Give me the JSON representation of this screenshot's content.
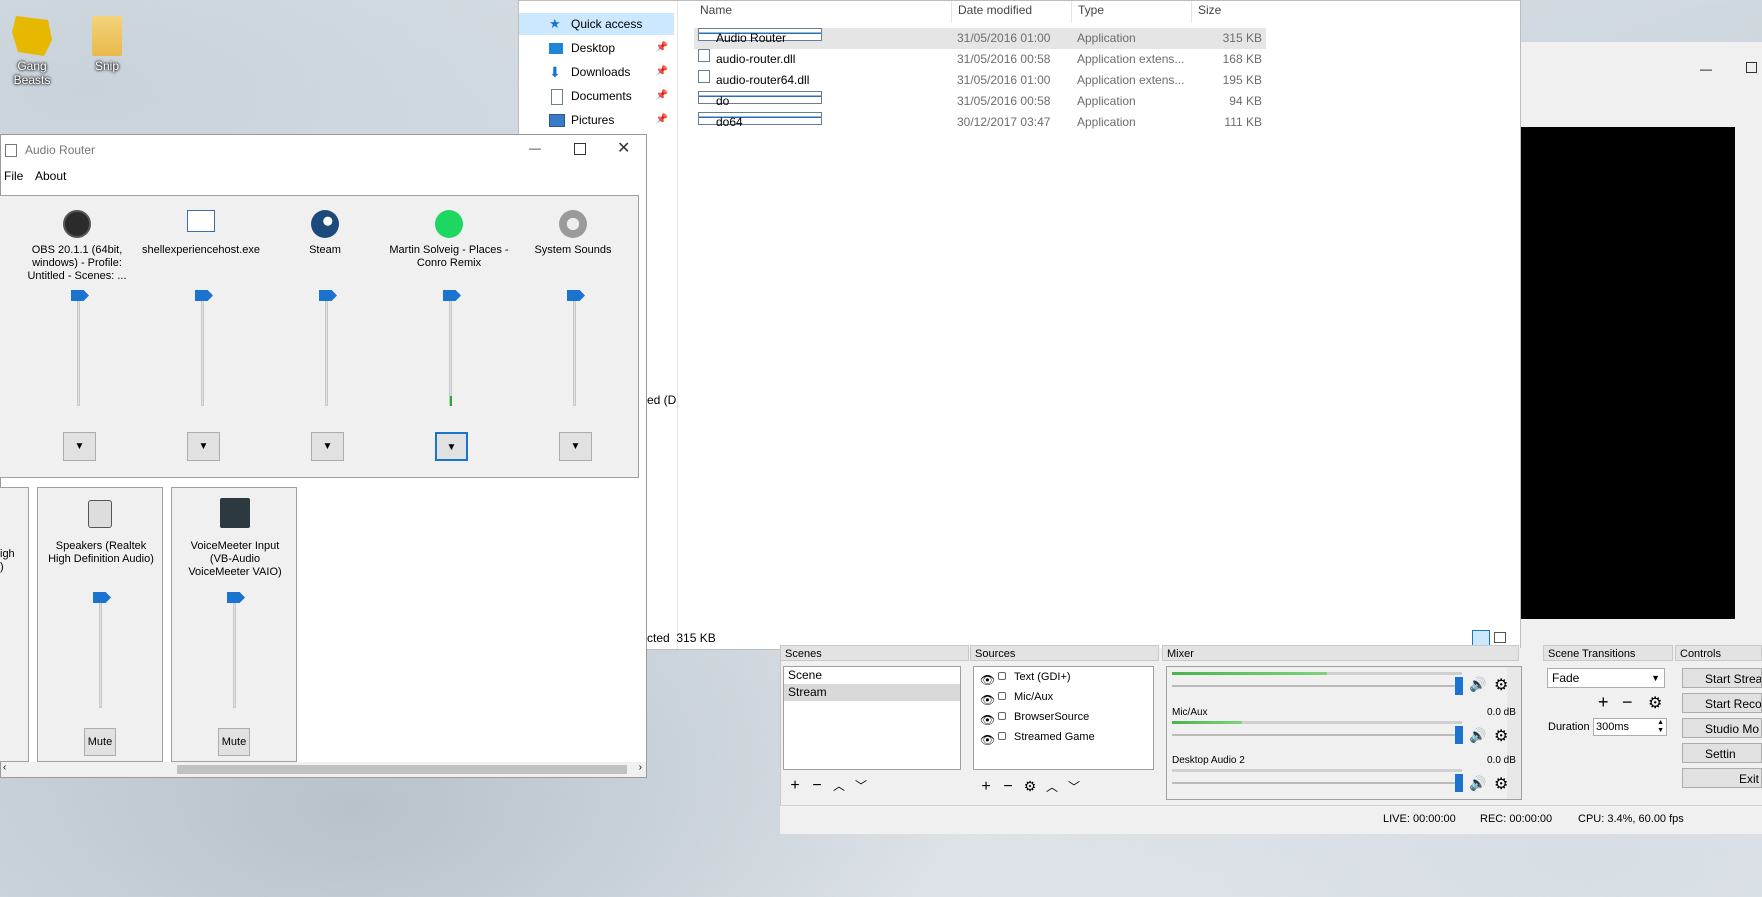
{
  "desktop": {
    "icons": [
      {
        "label": "Gang Beasts"
      },
      {
        "label": "Snip"
      }
    ]
  },
  "explorer": {
    "nav": [
      {
        "label": "Quick access",
        "icon": "star-icon"
      },
      {
        "label": "Desktop",
        "icon": "desktop-folder-icon",
        "pinned": true
      },
      {
        "label": "Downloads",
        "icon": "downloads-folder-icon",
        "pinned": true
      },
      {
        "label": "Documents",
        "icon": "documents-folder-icon",
        "pinned": true
      },
      {
        "label": "Pictures",
        "icon": "pictures-folder-icon",
        "pinned": true
      }
    ],
    "columns": [
      "Name",
      "Date modified",
      "Type",
      "Size"
    ],
    "files": [
      {
        "name": "Audio Router",
        "date": "31/05/2016 01:00",
        "type": "Application",
        "size": "315 KB"
      },
      {
        "name": "audio-router.dll",
        "date": "31/05/2016 00:58",
        "type": "Application extens...",
        "size": "168 KB"
      },
      {
        "name": "audio-router64.dll",
        "date": "31/05/2016 01:00",
        "type": "Application extens...",
        "size": "195 KB"
      },
      {
        "name": "do",
        "date": "31/05/2016 00:58",
        "type": "Application",
        "size": "94 KB"
      },
      {
        "name": "do64",
        "date": "30/12/2017 03:47",
        "type": "Application",
        "size": "111 KB"
      }
    ],
    "partial_side_text": "ed (D",
    "status": "cted  315 KB"
  },
  "audio_router": {
    "title": "Audio Router",
    "menu": [
      "File",
      "About"
    ],
    "apps": [
      {
        "label": "OBS 20.1.1 (64bit, windows) - Profile: Untitled - Scenes: ...",
        "icon": "obs-icon"
      },
      {
        "label": "shellexperiencehost.exe",
        "icon": "window-icon"
      },
      {
        "label": "Steam",
        "icon": "steam-icon"
      },
      {
        "label": "Martin Solveig - Places - Conro Remix",
        "icon": "spotify-icon"
      },
      {
        "label": "System Sounds",
        "icon": "speaker-icon"
      }
    ],
    "devices_partial": "igh\n)",
    "devices": [
      {
        "label": "Speakers (Realtek High Definition Audio)",
        "mute": "Mute"
      },
      {
        "label": "VoiceMeeter Input (VB-Audio VoiceMeeter VAIO)",
        "mute": "Mute"
      }
    ],
    "colors": {
      "accent": "#1b73d0"
    }
  },
  "obs": {
    "docks": {
      "scenes": "Scenes",
      "sources": "Sources",
      "mixer": "Mixer",
      "transitions": "Scene Transitions",
      "controls": "Controls"
    },
    "scenes": [
      {
        "label": "Scene"
      },
      {
        "label": "Stream",
        "selected": true
      }
    ],
    "sources": [
      "Text (GDI+)",
      "Mic/Aux",
      "BrowserSource",
      "Streamed Game"
    ],
    "mixer": [
      {
        "label": "",
        "db": "",
        "level": 0.4
      },
      {
        "label": "Mic/Aux",
        "db": "0.0 dB",
        "level": 0.2
      },
      {
        "label": "Desktop Audio 2",
        "db": "0.0 dB",
        "level": 0.0
      }
    ],
    "transition": {
      "value": "Fade",
      "duration_label": "Duration",
      "duration": "300ms"
    },
    "controls": [
      "Start Strea",
      "Start Recor",
      "Studio Mo",
      "Settin",
      "Exit"
    ],
    "status": {
      "live": "LIVE: 00:00:00",
      "rec": "REC: 00:00:00",
      "cpu": "CPU: 3.4%, 60.00 fps"
    }
  }
}
